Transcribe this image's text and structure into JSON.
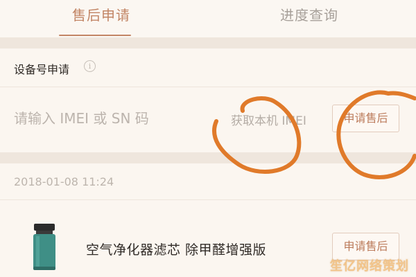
{
  "tabs": {
    "aftersale": "售后申请",
    "progress": "进度查询",
    "active": "aftersale"
  },
  "device_section": {
    "title": "设备号申请",
    "info_icon": "info-icon",
    "imei_placeholder": "请输入 IMEI 或 SN 码",
    "get_imei_label": "获取本机 IMEI",
    "apply_button": "申请售后"
  },
  "order": {
    "date": "2018-01-08 11:24",
    "product_name": "空气净化器滤芯  除甲醛增强版",
    "product_icon": "filter-cartridge-image",
    "apply_button": "申请售后"
  },
  "watermark": "笙亿网络策划",
  "colors": {
    "accent": "#c28565",
    "annotation": "#e07a2a",
    "background": "#f6eee6"
  }
}
